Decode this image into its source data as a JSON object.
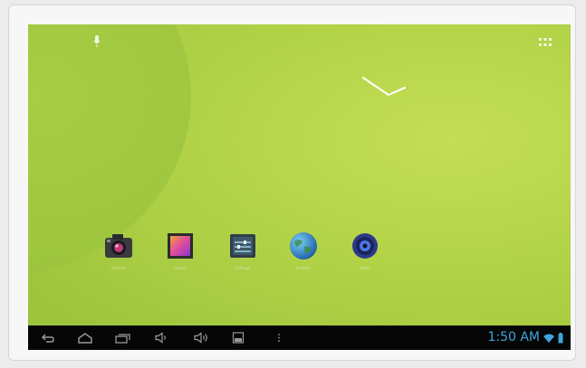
{
  "home": {
    "apps": [
      {
        "label": "Camera",
        "icon": "camera-icon"
      },
      {
        "label": "Gallery",
        "icon": "gallery-icon"
      },
      {
        "label": "Settings",
        "icon": "settings-icon"
      },
      {
        "label": "Browser",
        "icon": "browser-globe-icon"
      },
      {
        "label": "Music",
        "icon": "music-speaker-icon"
      }
    ]
  },
  "navbar": {
    "buttons": [
      "back-icon",
      "home-icon",
      "recent-apps-icon",
      "volume-down-icon",
      "volume-up-icon",
      "screenshot-icon",
      "menu-icon"
    ]
  },
  "status": {
    "time": "1:50 AM",
    "accent_color": "#3fa6dc"
  }
}
